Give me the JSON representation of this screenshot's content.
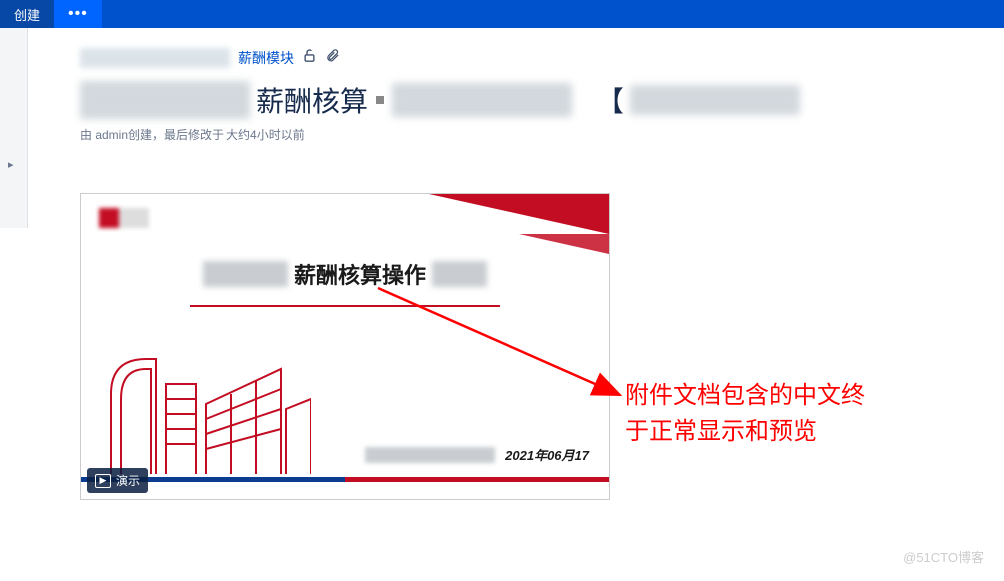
{
  "topbar": {
    "create_label": "创建",
    "more_label": "•••"
  },
  "breadcrumb": {
    "module_link": "薪酬模块"
  },
  "title": {
    "main": "薪酬核算"
  },
  "meta": {
    "prefix": "由 admin创建，最后修改于",
    "suffix": "大约4小时以前"
  },
  "attachment": {
    "title": "薪酬核算操作",
    "date": "2021年06月17",
    "preview_label": "演示"
  },
  "annotation": {
    "line1": "附件文档包含的中文终",
    "line2": "于正常显示和预览"
  },
  "watermark": "@51CTO博客"
}
